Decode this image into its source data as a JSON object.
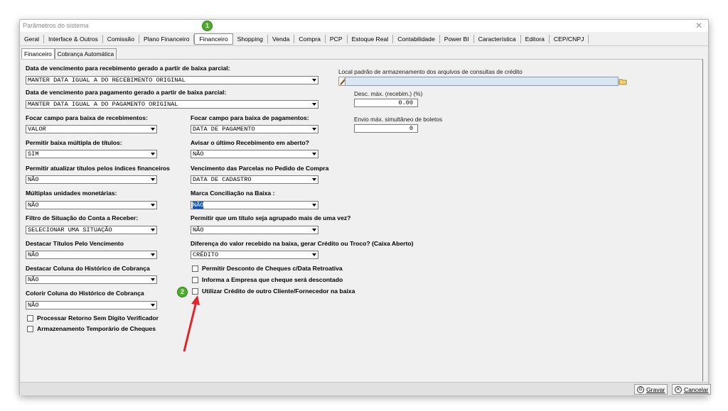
{
  "window": {
    "title": "Parâmetros do sistema",
    "close": "✕"
  },
  "main_tabs": [
    "Geral",
    "Interface & Outros",
    "Comissão",
    "Plano Financeiro",
    "Financeiro",
    "Shopping",
    "Venda",
    "Compra",
    "PCP",
    "Estoque Real",
    "Contabilidade",
    "Power BI",
    "Característica",
    "Editora",
    "CEP/CNPJ"
  ],
  "active_main_tab": "Financeiro",
  "sub_tabs": [
    "Financeiro",
    "Cobrança Automática"
  ],
  "fields": {
    "venc_receb_label": "Data de vencimento para recebimento gerado a partir de baixa parcial:",
    "venc_receb_value": "MANTER DATA IGUAL A DO RECEBIMENTO ORIGINAL",
    "venc_pag_label": "Data de vencimento para pagamento gerado a partir de baixa parcial:",
    "venc_pag_value": "MANTER DATA IGUAL A DO PAGAMENTO ORIGINAL",
    "focar_receb_label": "Focar campo para baixa de recebimentos:",
    "focar_receb_value": "VALOR",
    "focar_pag_label": "Focar campo para baixa de pagamentos:",
    "focar_pag_value": "DATA DE PAGAMENTO",
    "baixa_multipla_label": "Permitir baixa múltipla de títulos:",
    "baixa_multipla_value": "SIM",
    "avisar_label": "Avisar o último Recebimento em aberto?",
    "avisar_value": "NÃO",
    "atualizar_label": "Permitir atualizar títulos pelos índices financeiros",
    "atualizar_value": "NÃO",
    "venc_parcelas_label": "Vencimento das Parcelas no Pedido de Compra",
    "venc_parcelas_value": "DATA DE CADASTRO",
    "multiplas_label": "Múltiplas unidades monetárias:",
    "multiplas_value": "NÃO",
    "marca_label": "Marca Conciliação na Baixa :",
    "marca_value": "NÃO",
    "filtro_label": "Filtro de Situação do Conta a Receber:",
    "filtro_value": "SELECIONAR UMA SITUAÇÃO",
    "agrupado_label": "Permitir que um título seja agrupado mais de uma vez?",
    "agrupado_value": "NÃO",
    "destacar_label": "Destacar Títulos Pelo Vencimento",
    "destacar_value": "NÃO",
    "diferenca_label": "Diferença do valor recebido na baixa, gerar Crédito ou Troco? (Caixa Aberto)",
    "diferenca_value": "CRÉDITO",
    "destacar_col_label": "Destacar Coluna do Histórico de Cobrança",
    "destacar_col_value": "NÃO",
    "colorir_label": "Colorir Coluna do Histórico de Cobrança",
    "colorir_value": "NÃO",
    "local_label": "Local padrão de armazenamento dos arquivos de consultas de crédito",
    "desc_label": "Desc. máx. (recebim.) (%)",
    "desc_value": "0.00",
    "envio_label": "Envio máx. simultâneo de boletos",
    "envio_value": "0"
  },
  "checkboxes": {
    "processar": "Processar Retorno Sem Dígito Verificador",
    "armazenamento": "Armazenamento Temporário de Cheques",
    "desconto": "Permitir Desconto de Cheques c/Data Retroativa",
    "informa": "Informa a Empresa que cheque será descontado",
    "utilizar": "Utilizar Crédito de outro Cliente/Fornecedor na baixa"
  },
  "badges": {
    "one": "1",
    "two": "2"
  },
  "buttons": {
    "gravar": "Gravar",
    "cancelar": "Cancelar"
  },
  "colors": {
    "badge": "#4caf2a",
    "arrow": "#e0262a",
    "selection": "#0a56c8"
  }
}
